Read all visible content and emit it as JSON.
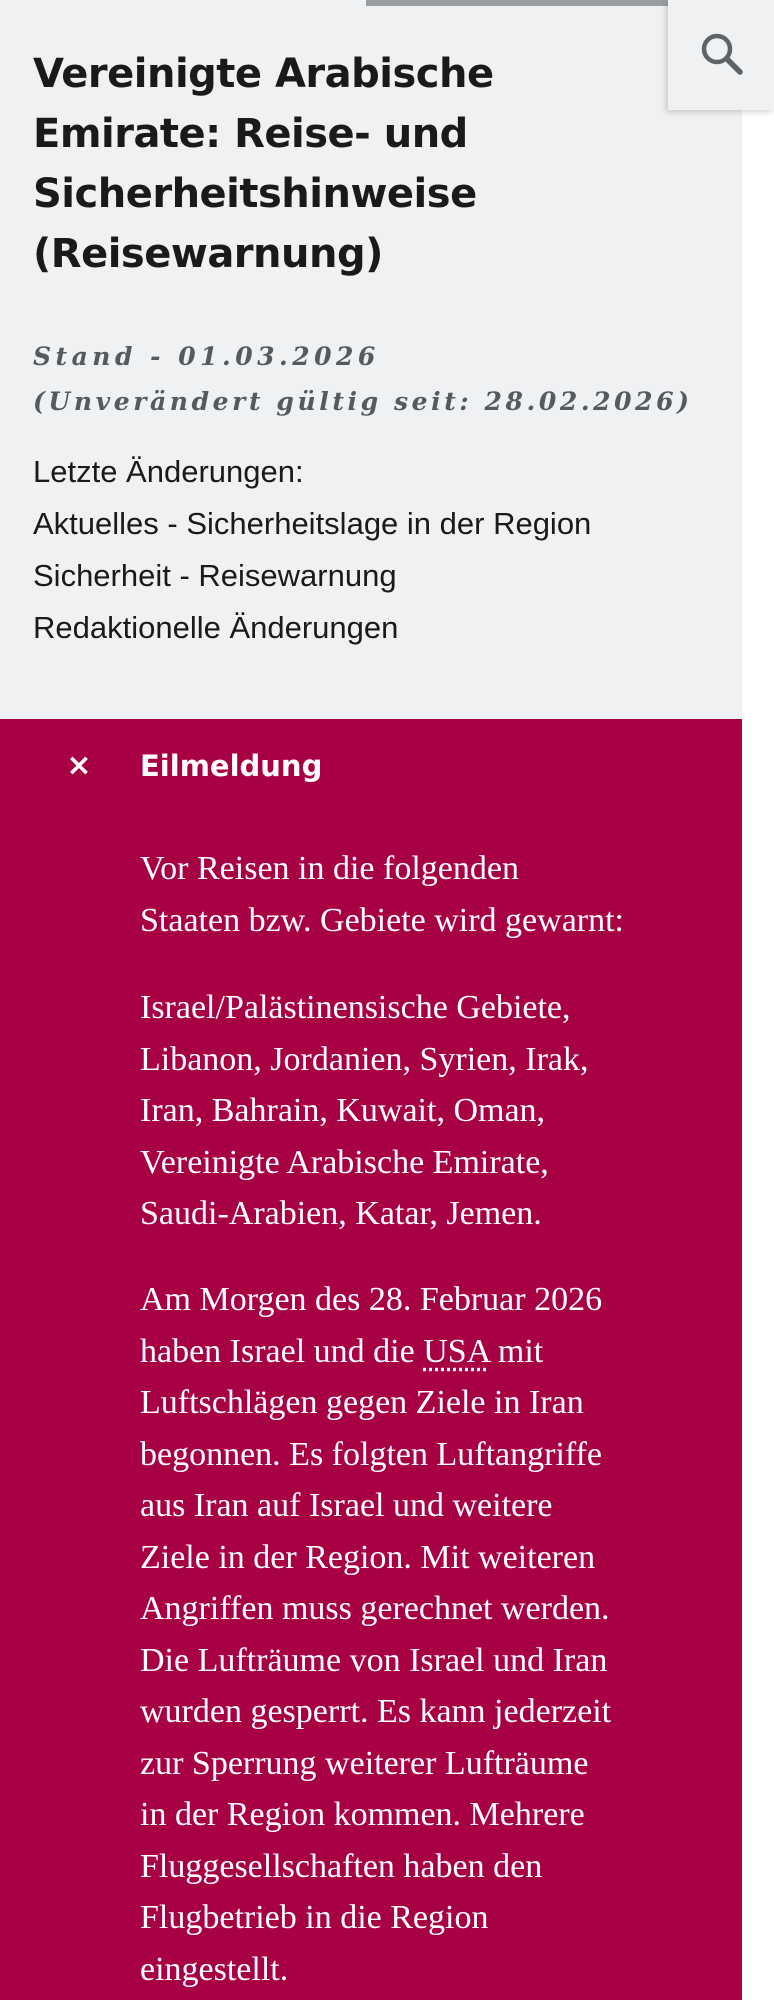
{
  "header": {
    "title_lines": [
      "Vereinigte Arabische",
      "Emirate: Reise- und",
      "Sicherheitshinweise",
      "(Reisewarnung)"
    ],
    "stand": "Stand - 01.03.2026",
    "unchanged_since": "(Unverändert gültig seit: 28.02.2026)",
    "changes_heading": "Letzte Änderungen:",
    "changes": [
      "Aktuelles - Sicherheitslage in der Region",
      "Sicherheit - Reisewarnung",
      "Redaktionelle Änderungen"
    ]
  },
  "search": {
    "icon": "search-icon"
  },
  "alert": {
    "close_symbol": "×",
    "title": "Eilmeldung",
    "para1_lines": [
      "Vor Reisen in die folgenden",
      "Staaten bzw. Gebiete wird gewarnt:"
    ],
    "para2_lines": [
      "Israel/Palästinensische Gebiete,",
      "Libanon, Jordanien, Syrien, Irak,",
      "Iran, Bahrain, Kuwait, Oman,",
      "Vereinigte Arabische Emirate,",
      "Saudi-Arabien, Katar, Jemen."
    ],
    "para3_line1": "Am Morgen des 28. Februar 2026",
    "para3_line2_before": "haben Israel und die ",
    "para3_link": "USA",
    "para3_line2_after": " mit",
    "para3_lines_rest": [
      "Luftschlägen gegen Ziele in Iran",
      "begonnen. Es folgten Luftangriffe",
      "aus Iran auf Israel und weitere",
      "Ziele in der Region. Mit weiteren",
      "Angriffen muss gerechnet werden.",
      "Die Lufträume von Israel und Iran",
      "wurden gesperrt. Es kann jederzeit",
      "zur Sperrung weiterer Lufträume",
      "in der Region kommen. Mehrere",
      "Fluggesellschaften haben den",
      "Flugbetrieb in die Region",
      "eingestellt."
    ]
  },
  "colors": {
    "header_bg": "#eff1f3",
    "alert_bg": "#a80044",
    "text_dark": "#1a1a1a",
    "meta_gray": "#555a5f"
  }
}
